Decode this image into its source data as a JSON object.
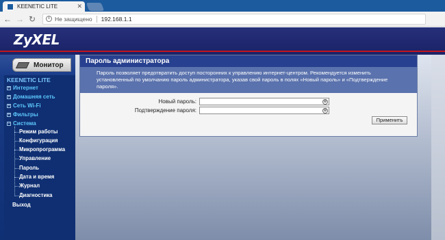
{
  "browser": {
    "tab_title": "KEENETIC LITE",
    "tab_close": "✕",
    "security_text": "Не защищено",
    "url": "192.168.1.1"
  },
  "header": {
    "logo": "ZyXEL"
  },
  "sidebar": {
    "monitor_label": "Монитор",
    "device_name": "KEENETIC LITE",
    "items": [
      {
        "label": "Интернет"
      },
      {
        "label": "Домашняя сеть"
      },
      {
        "label": "Сеть Wi-Fi"
      },
      {
        "label": "Фильтры"
      },
      {
        "label": "Система"
      }
    ],
    "system_subitems": [
      {
        "label": "Режим работы"
      },
      {
        "label": "Конфигурация"
      },
      {
        "label": "Микропрограмма"
      },
      {
        "label": "Управление"
      },
      {
        "label": "Пароль"
      },
      {
        "label": "Дата и время"
      },
      {
        "label": "Журнал"
      },
      {
        "label": "Диагностика"
      }
    ],
    "exit_label": "Выход"
  },
  "main": {
    "title": "Пароль администратора",
    "description": "Пароль позволяет предотвратить доступ посторонних к управлению интернет-центром. Рекомендуется изменить установленный по умолчанию пароль администратора, указав свой пароль в полях «Новый пароль» и «Подтверждение пароля».",
    "new_password_label": "Новый пароль:",
    "new_password_value": "",
    "confirm_password_label": "Подтверждение пароля:",
    "confirm_password_value": "",
    "apply_label": "Применить"
  }
}
